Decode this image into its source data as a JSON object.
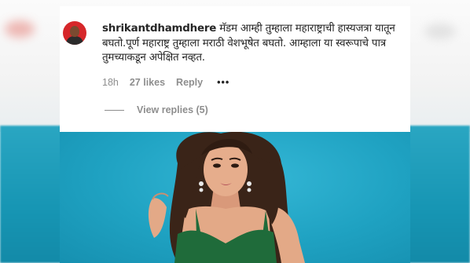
{
  "comment": {
    "username": "shrikantdhamdhere",
    "text": "मॅडम आम्ही तुम्हाला महाराष्ट्राची हास्यजत्रा यातून बघतो.पूर्ण महाराष्ट्र तुम्हाला मराठी वेशभूषेत बघतो. आम्हाला या स्वरूपाचे पात्र तुमच्याकडून अपेक्षित नव्हत.",
    "time": "18h",
    "likes": "27 likes",
    "reply_label": "Reply",
    "more_label": "•••",
    "view_replies_label": "View replies (5)"
  },
  "colors": {
    "card_bg": "#ffffff",
    "text": "#262626",
    "muted": "#8e8e8e",
    "photo_bg": "#1fa2c2",
    "avatar_bg": "#d6272a",
    "dress": "#1f6b3a"
  },
  "icons": {
    "avatar": "user-avatar",
    "more": "more-options-icon"
  }
}
